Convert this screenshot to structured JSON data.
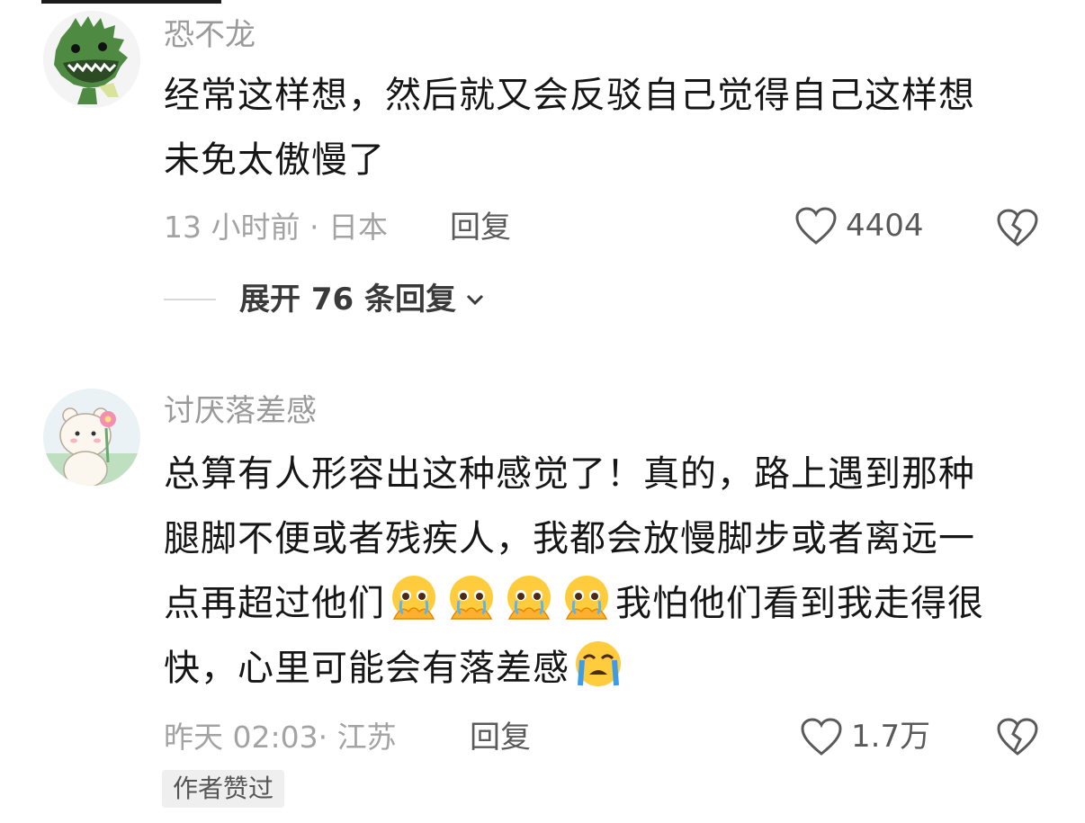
{
  "comments": [
    {
      "username": "恐不龙",
      "body_line1": "经常这样想，然后就又会反驳自己觉得自己这样想",
      "body_line2": "未免太傲慢了",
      "meta": "13 小时前 · 日本",
      "reply_label": "回复",
      "likes": "4404",
      "expand_label": "展开 76 条回复",
      "avatar_icon": "green-dinosaur-avatar"
    },
    {
      "username": "讨厌落差感",
      "body_line1": "总算有人形容出这种感觉了！真的，路上遇到那种",
      "body_line2": "腿脚不便或者残疾人，我都会放慢脚步或者离远一",
      "body_line3a": "点再超过他们",
      "body_line3b": "我怕他们看到我走得很",
      "body_line4": "快，心里可能会有落差感",
      "meta": "昨天 02:03· 江苏",
      "reply_label": "回复",
      "likes": "1.7万",
      "badge": "作者赞过",
      "avatar_icon": "bear-with-flower-avatar",
      "emojis": [
        "pleading-hands-emoji",
        "pleading-hands-emoji",
        "pleading-hands-emoji",
        "pleading-hands-emoji",
        "crying-face-emoji"
      ]
    }
  ],
  "colors": {
    "text": "#161616",
    "muted": "#a3a3a3",
    "action": "#5a5a5a"
  }
}
